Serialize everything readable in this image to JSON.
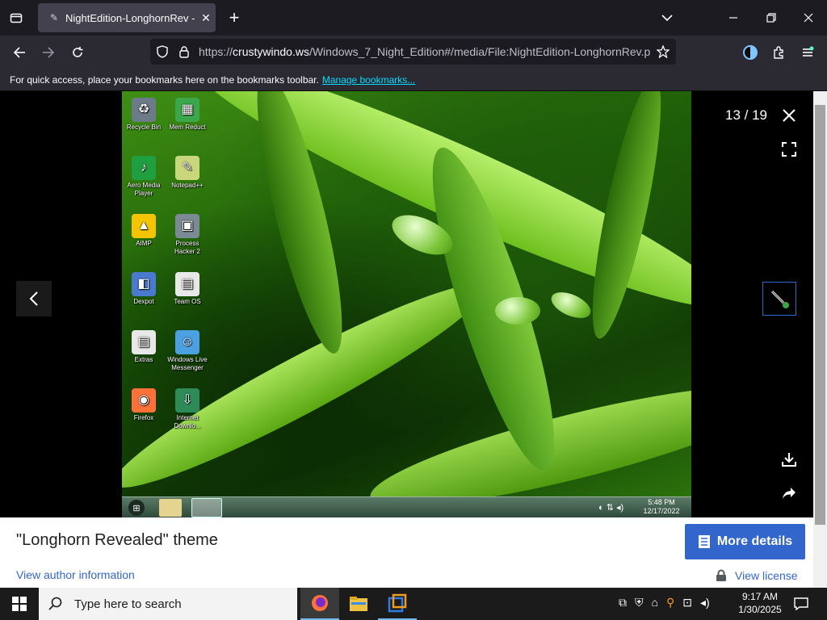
{
  "browser": {
    "tab_title": "NightEdition-LonghornRev - W",
    "url_scheme": "https://",
    "url_host": "crustywindo.ws",
    "url_path": "/Windows_7_Night_Edition#/media/File:NightEdition-LonghornRev.p",
    "bookmarks_message": "For quick access, place your bookmarks here on the bookmarks toolbar.",
    "bookmarks_link": "Manage bookmarks..."
  },
  "viewer": {
    "counter": "13 / 19",
    "desktop_icons": [
      {
        "label": "Recycle Bin",
        "icon": "recycle-bin-icon",
        "color": "#6c7a8a",
        "glyph": "♻"
      },
      {
        "label": "Mem Reduct",
        "icon": "mem-reduct-icon",
        "color": "#3aa84a",
        "glyph": "▦"
      },
      {
        "label": "Aero Media Player",
        "icon": "media-player-icon",
        "color": "#1f9f3f",
        "glyph": "♪"
      },
      {
        "label": "Notepad++",
        "icon": "notepad-icon",
        "color": "#c9d67a",
        "glyph": "✎"
      },
      {
        "label": "AIMP",
        "icon": "aimp-icon",
        "color": "#f4c400",
        "glyph": "▲"
      },
      {
        "label": "Process Hacker 2",
        "icon": "process-hacker-icon",
        "color": "#7b8a94",
        "glyph": "▣"
      },
      {
        "label": "Dexpot",
        "icon": "dexpot-icon",
        "color": "#4a7ad0",
        "glyph": "◧"
      },
      {
        "label": "Team OS",
        "icon": "folder-icon",
        "color": "#e8e8e8",
        "glyph": "▤"
      },
      {
        "label": "Extras",
        "icon": "folder-icon",
        "color": "#e8e8e8",
        "glyph": "▤"
      },
      {
        "label": "Windows Live Messenger",
        "icon": "messenger-icon",
        "color": "#4aa0e0",
        "glyph": "☺"
      },
      {
        "label": "Firefox",
        "icon": "firefox-icon",
        "color": "#ff7139",
        "glyph": "◉"
      },
      {
        "label": "Internet Downlo...",
        "icon": "idm-icon",
        "color": "#2e8b57",
        "glyph": "⇩"
      }
    ],
    "w7_clock_time": "5:48 PM",
    "w7_clock_date": "12/17/2022"
  },
  "caption": {
    "title": "\"Longhorn Revealed\" theme",
    "more_details": "More details",
    "author_link": "View author information",
    "license_link": "View license"
  },
  "taskbar": {
    "search_placeholder": "Type here to search",
    "time": "9:17 AM",
    "date": "1/30/2025"
  },
  "colors": {
    "accent": "#3366cc",
    "link": "#00ddff"
  }
}
